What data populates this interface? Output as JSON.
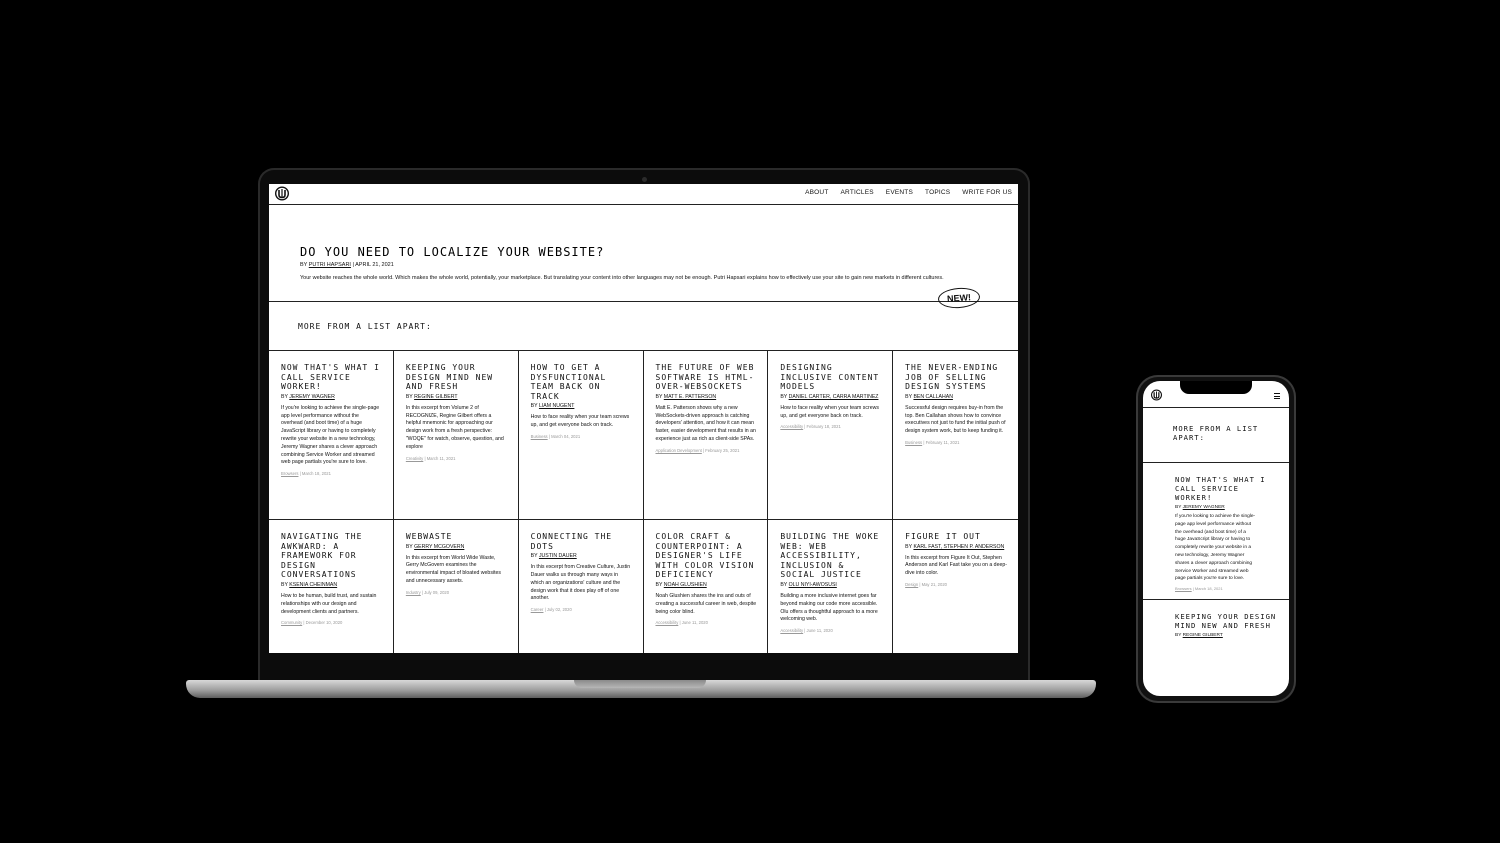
{
  "site": {
    "nav": [
      "ABOUT",
      "ARTICLES",
      "EVENTS",
      "TOPICS",
      "WRITE FOR US"
    ]
  },
  "hero": {
    "title": "DO YOU NEED TO LOCALIZE YOUR WEBSITE?",
    "by_prefix": "BY ",
    "author": "PUTRI HAPSARI",
    "date": " | APRIL 21, 2021",
    "summary": "Your website reaches the whole world. Which makes the whole world, potentially, your marketplace. But translating your content into other languages may not be enough. Putri Hapsari explains how to effectively use your site to gain new markets in different cultures.",
    "badge": "NEW!"
  },
  "more": {
    "title": "MORE FROM A LIST APART:"
  },
  "articles": [
    {
      "title": "NOW THAT'S WHAT I CALL SERVICE WORKER!",
      "author": "JEREMY WAGNER",
      "summary": "If you're looking to achieve the single-page app level performance without the overhead (and boot time) of a huge JavaScript library or having to completely rewrite your website in a new technology, Jeremy Wagner shares a clever approach combining Service Worker and streamed web page partials you're sure to love.",
      "topic": "Browsers",
      "date": " | March 18, 2021"
    },
    {
      "title": "KEEPING YOUR DESIGN MIND NEW AND FRESH",
      "author": "REGINE GILBERT",
      "summary": "In this excerpt from Volume 2 of RECOGNIZE, Regine Gilbert offers a helpful mnemonic for approaching our design work from a fresh perspective: \"WOQE\" for watch, observe, question, and explore",
      "topic": "Creativity",
      "date": " | March 11, 2021"
    },
    {
      "title": "HOW TO GET A DYSFUNCTIONAL TEAM BACK ON TRACK",
      "author": "LIAM NUGENT",
      "summary": "How to face reality when your team screws up, and get everyone back on track.",
      "topic": "Business",
      "date": " | March 04, 2021"
    },
    {
      "title": "THE FUTURE OF WEB SOFTWARE IS HTML-OVER-WEBSOCKETS",
      "author": "MATT E. PATTERSON",
      "summary": "Matt E. Patterson shows why a new WebSockets-driven approach is catching developers' attention, and how it can mean faster, easier development that results in an experience just as rich as client-side SPAs.",
      "topic": "Application Development",
      "date": " | February 25, 2021"
    },
    {
      "title": "DESIGNING INCLUSIVE CONTENT MODELS",
      "author": "DANIEL CARTER, CARRA MARTINEZ",
      "summary": "How to face reality when your team screws up, and get everyone back on track.",
      "topic": "Accessibility",
      "date": " | February 18, 2021"
    },
    {
      "title": "THE NEVER-ENDING JOB OF SELLING DESIGN SYSTEMS",
      "author": "BEN CALLAHAN",
      "summary": "Successful design requires buy-in from the top. Ben Callahan shows how to convince executives not just to fund the initial push of design system work, but to keep funding it.",
      "topic": "Business",
      "date": " | February 11, 2021"
    },
    {
      "title": "NAVIGATING THE AWKWARD: A FRAMEWORK FOR DESIGN CONVERSATIONS",
      "author": "KSENIA CHEINMAN",
      "summary": "How to be human, build trust, and sustain relationships with our design and development clients and partners.",
      "topic": "Community",
      "date": " | December 10, 2020"
    },
    {
      "title": "WEBWASTE",
      "author": "GERRY MCGOVERN",
      "summary": "In this excerpt from World Wide Waste, Gerry McGovern examines the environmental impact of bloated websites and unnecessary assets.",
      "topic": "Industry",
      "date": " | July 09, 2020"
    },
    {
      "title": "CONNECTING THE DOTS",
      "author": "JUSTIN DAUER",
      "summary": "In this excerpt from Creative Culture, Justin Dauer walks us through many ways in which an organizations' culture and the design work that it does play off of one another.",
      "topic": "Career",
      "date": " | July 02, 2020"
    },
    {
      "title": "COLOR CRAFT & COUNTERPOINT: A DESIGNER'S LIFE WITH COLOR VISION DEFICIENCY",
      "author": "NOAH GLUSHIEN",
      "summary": "Noah Glushien shares the ins and outs of creating a successful career in web, despite being color blind.",
      "topic": "Accessibility",
      "date": " | June 11, 2020"
    },
    {
      "title": "BUILDING THE WOKE WEB: WEB ACCESSIBILITY, INCLUSION & SOCIAL JUSTICE",
      "author": "OLU NIYI-AWOSUSI",
      "summary": "Building a more inclusive internet goes far beyond making our code more accessible. Olu offers a thoughtful approach to a more welcoming web.",
      "topic": "Accessibility",
      "date": " | June 11, 2020"
    },
    {
      "title": "FIGURE IT OUT",
      "author": "KARL FAST, STEPHEN P. ANDERSON",
      "summary": "In this excerpt from Figure It Out, Stephen Anderson and Karl Fast take you on a deep-dive into color.",
      "topic": "Design",
      "date": " | May 21, 2020"
    }
  ],
  "mobile": {
    "more_title": "MORE FROM A LIST APART:",
    "cards": [
      {
        "title": "NOW THAT'S WHAT I CALL SERVICE WORKER!",
        "author": "JEREMY WAGNER",
        "summary": "If you're looking to achieve the single-page app level performance without the overhead (and boot time) of a huge JavaScript library or having to completely rewrite your website in a new technology, Jeremy Wagner shares a clever approach combining Service Worker and streamed web page partials you're sure to love.",
        "topic": "Browsers",
        "date": " | March 18, 2021"
      },
      {
        "title": "KEEPING YOUR DESIGN MIND NEW AND FRESH",
        "author": "REGINE GILBERT"
      }
    ]
  }
}
